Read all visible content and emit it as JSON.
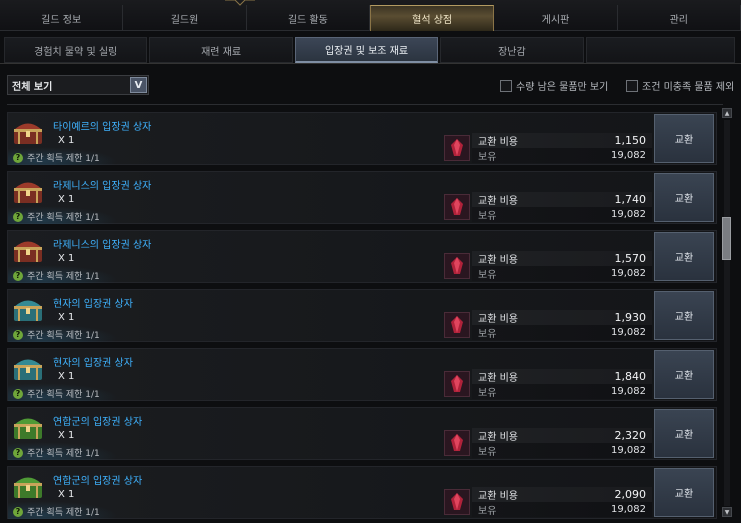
{
  "top_tabs": [
    "길드 정보",
    "길드원",
    "길드 활동",
    "혈석 상점",
    "게시판",
    "관리"
  ],
  "sub_tabs": [
    "경험치 물약 및 실링",
    "재련 재료",
    "입장권 및 보조 재료",
    "장난감"
  ],
  "filter": {
    "selected": "전체 보기",
    "arrow": "V"
  },
  "checkboxes": {
    "remaining_only": "수량 남은 물품만 보기",
    "exclude_unmet": "조건 미충족 물품 제외"
  },
  "colors": {
    "accent_gold": "#b39b62",
    "item_blue": "#3fb3ff",
    "button": "#3a4452"
  },
  "items": [
    {
      "name": "타이예르의 입장권 상자",
      "qty": "X 1",
      "limit": "주간 획득 제한 1/1",
      "cost_label": "교환 비용",
      "cost": "1,150",
      "owned_label": "보유",
      "owned": "19,082",
      "button": "교환",
      "chest_color": "red"
    },
    {
      "name": "라제니스의 입장권 상자",
      "qty": "X 1",
      "limit": "주간 획득 제한 1/1",
      "cost_label": "교환 비용",
      "cost": "1,740",
      "owned_label": "보유",
      "owned": "19,082",
      "button": "교환",
      "chest_color": "red"
    },
    {
      "name": "라제니스의 입장권 상자",
      "qty": "X 1",
      "limit": "주간 획득 제한 1/1",
      "cost_label": "교환 비용",
      "cost": "1,570",
      "owned_label": "보유",
      "owned": "19,082",
      "button": "교환",
      "chest_color": "red"
    },
    {
      "name": "현자의 입장권 상자",
      "qty": "X 1",
      "limit": "주간 획득 제한 1/1",
      "cost_label": "교환 비용",
      "cost": "1,930",
      "owned_label": "보유",
      "owned": "19,082",
      "button": "교환",
      "chest_color": "teal"
    },
    {
      "name": "현자의 입장권 상자",
      "qty": "X 1",
      "limit": "주간 획득 제한 1/1",
      "cost_label": "교환 비용",
      "cost": "1,840",
      "owned_label": "보유",
      "owned": "19,082",
      "button": "교환",
      "chest_color": "teal"
    },
    {
      "name": "연합군의 입장권 상자",
      "qty": "X 1",
      "limit": "주간 획득 제한 1/1",
      "cost_label": "교환 비용",
      "cost": "2,320",
      "owned_label": "보유",
      "owned": "19,082",
      "button": "교환",
      "chest_color": "green"
    },
    {
      "name": "연합군의 입장권 상자",
      "qty": "X 1",
      "limit": "주간 획득 제한 1/1",
      "cost_label": "교환 비용",
      "cost": "2,090",
      "owned_label": "보유",
      "owned": "19,082",
      "button": "교환",
      "chest_color": "green"
    }
  ]
}
